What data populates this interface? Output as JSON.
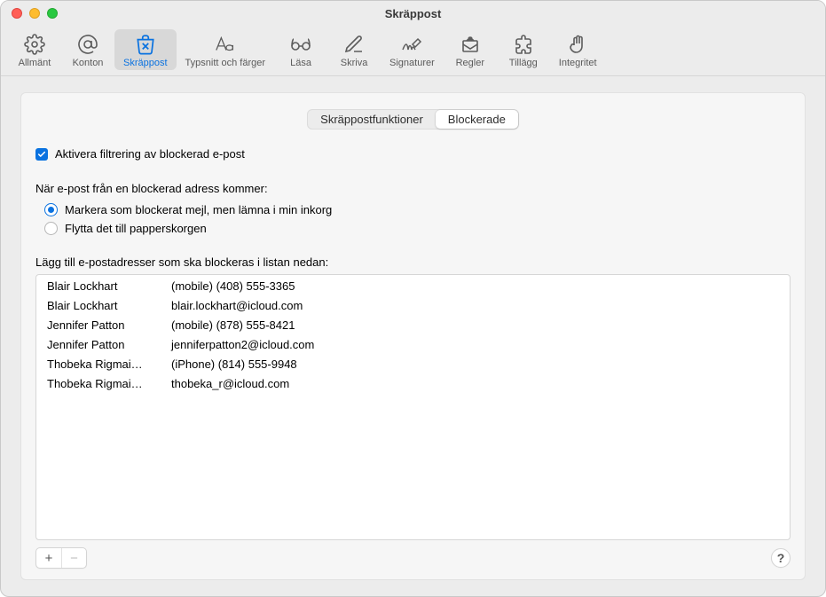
{
  "window": {
    "title": "Skräppost"
  },
  "toolbar": [
    {
      "id": "general",
      "label": "Allmänt"
    },
    {
      "id": "accounts",
      "label": "Konton"
    },
    {
      "id": "junk",
      "label": "Skräppost",
      "selected": true
    },
    {
      "id": "fonts",
      "label": "Typsnitt och färger"
    },
    {
      "id": "reading",
      "label": "Läsa"
    },
    {
      "id": "compose",
      "label": "Skriva"
    },
    {
      "id": "sign",
      "label": "Signaturer"
    },
    {
      "id": "rules",
      "label": "Regler"
    },
    {
      "id": "ext",
      "label": "Tillägg"
    },
    {
      "id": "priv",
      "label": "Integritet"
    }
  ],
  "tabs": {
    "junk": "Skräppostfunktioner",
    "blocked": "Blockerade",
    "active": "blocked"
  },
  "enable_label": "Aktivera filtrering av blockerad e-post",
  "when_label": "När e-post från en blockerad adress kommer:",
  "radio_mark": "Markera som blockerat mejl, men lämna i min inkorg",
  "radio_trash": "Flytta det till papperskorgen",
  "radio_selected": "mark",
  "list_instruction": "Lägg till e-postadresser som ska blockeras i listan nedan:",
  "blocked_list": [
    {
      "name": "Blair Lockhart",
      "value": "(mobile) (408) 555-3365"
    },
    {
      "name": "Blair Lockhart",
      "value": "blair.lockhart@icloud.com"
    },
    {
      "name": "Jennifer Patton",
      "value": "(mobile) (878) 555-8421"
    },
    {
      "name": "Jennifer Patton",
      "value": "jenniferpatton2@icloud.com"
    },
    {
      "name": "Thobeka Rigmai…",
      "value": "(iPhone) (814) 555-9948"
    },
    {
      "name": "Thobeka Rigmai…",
      "value": "thobeka_r@icloud.com"
    }
  ],
  "buttons": {
    "add": "+",
    "remove": "−",
    "help": "?"
  }
}
